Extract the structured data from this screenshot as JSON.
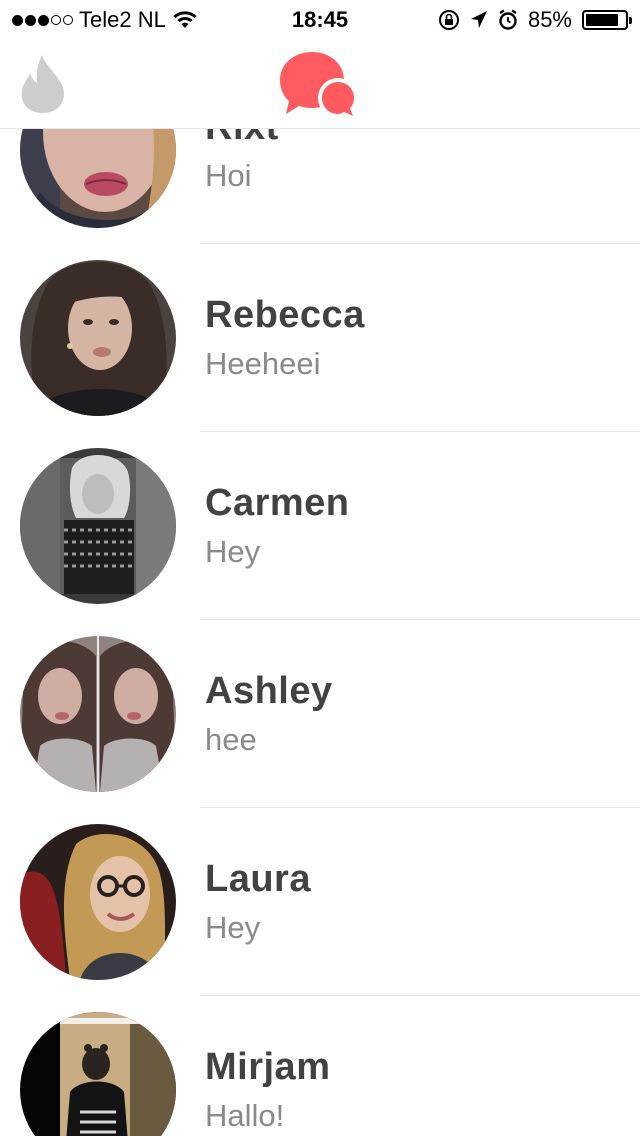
{
  "status_bar": {
    "carrier": "Tele2 NL",
    "time": "18:45",
    "battery_percent_label": "85%",
    "battery_level": 0.85,
    "signal_bars": 3,
    "signal_total": 5,
    "icons": [
      "wifi-icon",
      "rotation-lock-icon",
      "location-arrow-icon",
      "alarm-icon",
      "battery-icon"
    ]
  },
  "nav": {
    "left_icon": "flame-icon",
    "center_icon": "chat-bubbles-icon",
    "accent_color": "#fd5b5f",
    "inactive_color": "#cdcdcd"
  },
  "matches": [
    {
      "name": "Rixt",
      "message": "Hoi"
    },
    {
      "name": "Rebecca",
      "message": "Heeheei"
    },
    {
      "name": "Carmen",
      "message": "Hey"
    },
    {
      "name": "Ashley",
      "message": "hee"
    },
    {
      "name": "Laura",
      "message": "Hey"
    },
    {
      "name": "Mirjam",
      "message": "Hallo!"
    }
  ]
}
